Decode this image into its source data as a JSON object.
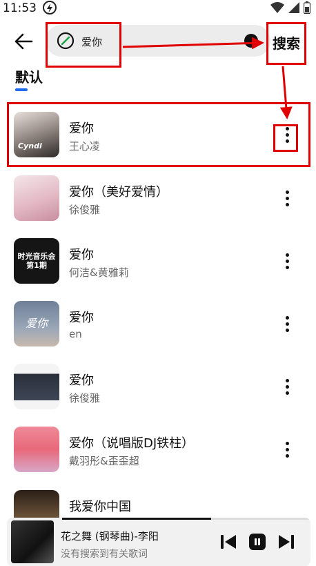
{
  "status_bar": {
    "time": "11:53",
    "icons": [
      "flash-icon",
      "wifi-icon",
      "signal-icon",
      "battery-icon"
    ]
  },
  "header": {
    "back_icon": "arrow-left-icon",
    "search": {
      "value": "爱你",
      "logo_icon": "music-app-logo-icon",
      "clear_icon": "clear-icon"
    },
    "search_button": "搜索"
  },
  "tabs": [
    {
      "label": "默认",
      "active": true
    }
  ],
  "songs": [
    {
      "title": "爱你",
      "artist": "王心凌",
      "cover_text": "Cyndi",
      "cover_color": "#3a3a3a"
    },
    {
      "title": "爱你（美好爱情）",
      "artist": "徐俊雅",
      "cover_text": "",
      "cover_color": "#e9c8cf"
    },
    {
      "title": "爱你",
      "artist": "何洁&黄雅莉",
      "cover_text": "时光音乐会 第1期",
      "cover_color": "#151515"
    },
    {
      "title": "爱你",
      "artist": "en",
      "cover_text": "爱你",
      "cover_color": "#7d8ea8"
    },
    {
      "title": "爱你",
      "artist": "徐俊雅",
      "cover_text": "",
      "cover_color": "#2a2f3a"
    },
    {
      "title": "爱你（说唱版DJ铁柱）",
      "artist": "戴羽彤&歪歪超",
      "cover_text": "",
      "cover_color": "#e7697a"
    },
    {
      "title": "我爱你中国",
      "artist": "",
      "cover_text": "",
      "cover_color": "#3b2a1e"
    }
  ],
  "player": {
    "title": "花之舞 (钢琴曲)-李阳",
    "lyric": "没有搜索到有关歌词",
    "progress": 0.6,
    "controls": [
      "previous-icon",
      "pause-icon",
      "next-icon"
    ]
  },
  "annotation_color": "#e00000"
}
